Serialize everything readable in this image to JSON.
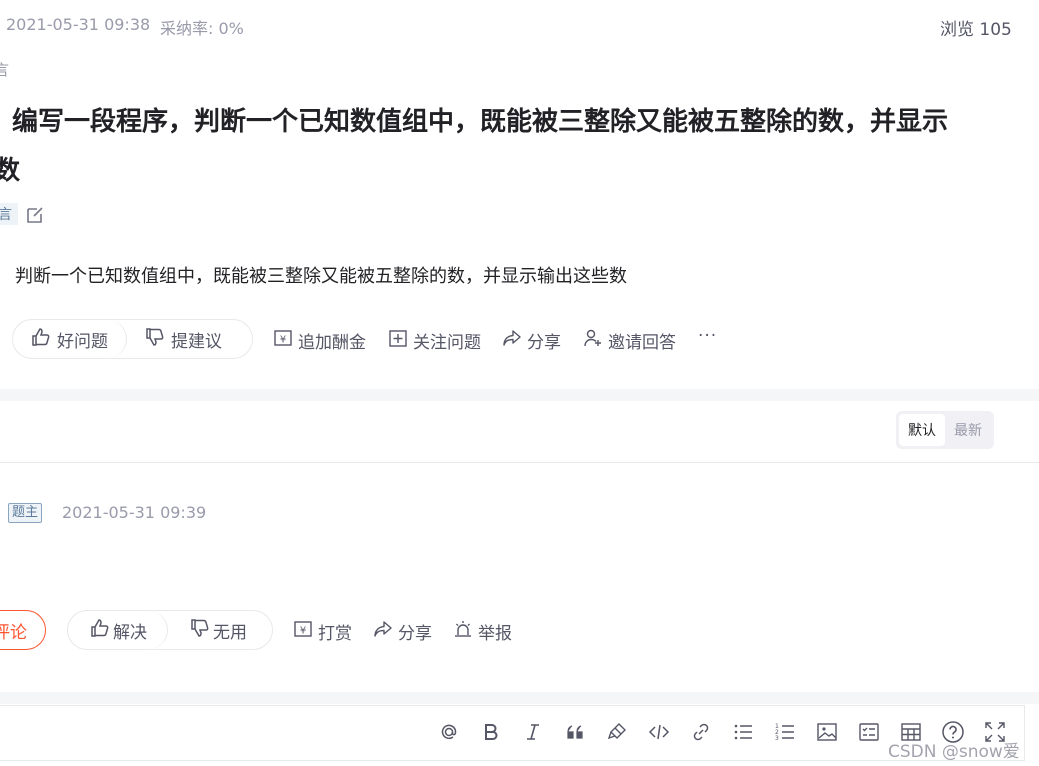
{
  "header": {
    "date": "2021-05-31 09:38",
    "adoption_rate": "采纳率: 0%",
    "views": "浏览 105",
    "category_fragment": "言"
  },
  "question": {
    "title_line1": "编写一段程序，判断一个已知数值组中，既能被三整除又能被五整除的数，并显示",
    "title_line2": "数",
    "tag_fragment": "言",
    "body": "判断一个已知数值组中，既能被三整除又能被五整除的数，并显示输出这些数"
  },
  "question_actions": {
    "good_question": "好问题",
    "suggest": "提建议",
    "add_bounty": "追加酬金",
    "follow": "关注问题",
    "share": "分享",
    "invite": "邀请回答",
    "more": "···"
  },
  "sort": {
    "default": "默认",
    "latest": "最新"
  },
  "answer": {
    "owner_tag": "题主",
    "date": "2021-05-31 09:39",
    "comment_fragment": "评论",
    "solved": "解决",
    "useless": "无用",
    "tip": "打赏",
    "share": "分享",
    "report": "举报"
  },
  "editor_toolbar": {
    "icons": [
      "at-icon",
      "bold-icon",
      "italic-icon",
      "quote-icon",
      "clear-format-icon",
      "code-icon",
      "link-icon",
      "bullet-list-icon",
      "ordered-list-icon",
      "image-icon",
      "todo-icon",
      "table-icon",
      "help-icon",
      "fullscreen-icon"
    ]
  },
  "watermark": "CSDN @snow爱"
}
